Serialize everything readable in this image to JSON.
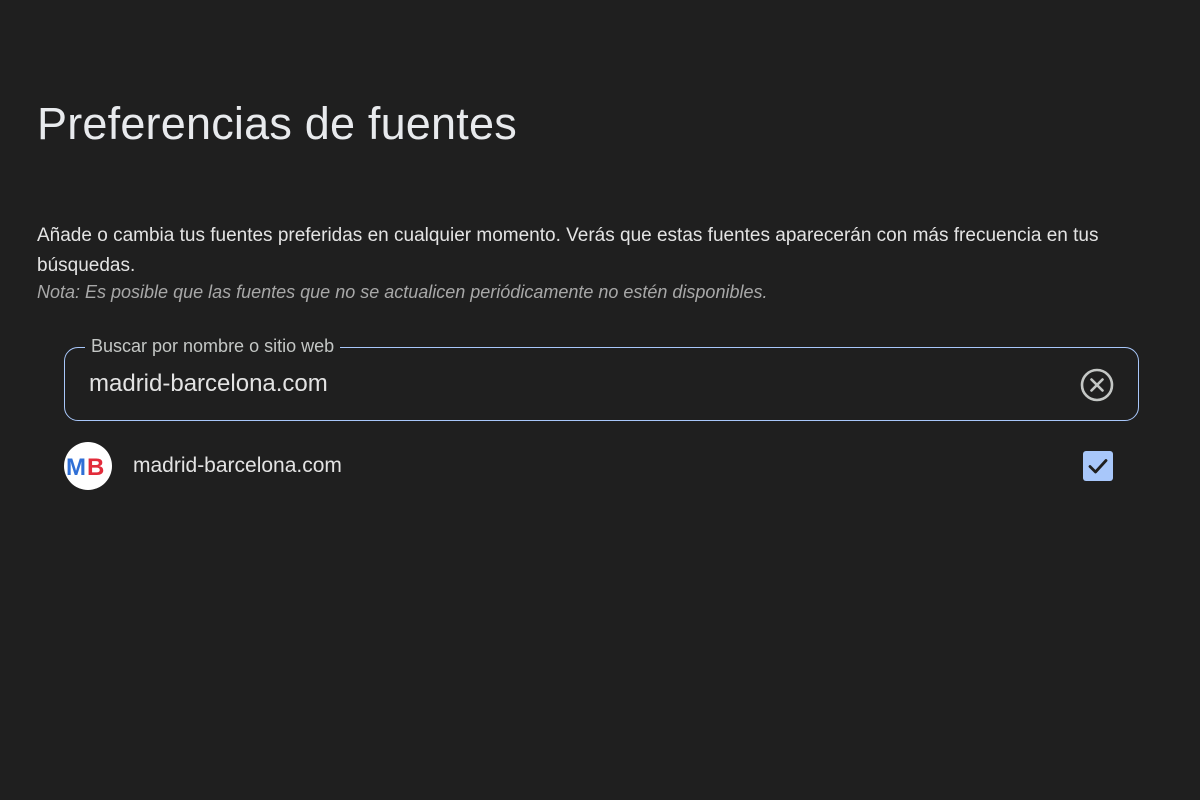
{
  "page": {
    "title": "Preferencias de fuentes",
    "description": "Añade o cambia tus fuentes preferidas en cualquier momento. Verás que estas fuentes aparecerán con más frecuencia en tus búsquedas.",
    "note": "Nota: Es posible que las fuentes que no se actualicen periódicamente no estén disponibles."
  },
  "search": {
    "label": "Buscar por nombre o sitio web",
    "value": "madrid-barcelona.com",
    "clear_icon": "clear-circle-x-icon"
  },
  "results": [
    {
      "label": "madrid-barcelona.com",
      "logo_text": "MB",
      "checked": true
    }
  ],
  "colors": {
    "background": "#1f1f1f",
    "accent": "#a8c7fa",
    "logo_blue": "#2f6fd6",
    "logo_red": "#e22b3a"
  }
}
